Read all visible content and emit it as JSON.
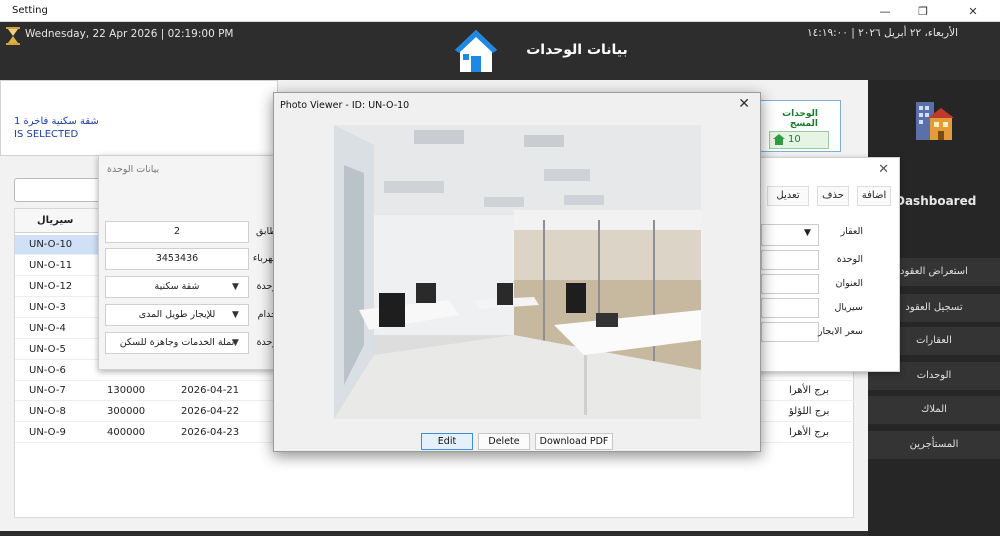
{
  "window": {
    "title": "Setting"
  },
  "topbar": {
    "datetime_en": "Wednesday, 22 Apr 2026  |  02:19:00 PM",
    "datetime_ar": "الأربعاء، ٢٢ أبريل ٢٠٢٦ | ١٤:١٩:٠٠",
    "page_title": "بيانات الوحدات"
  },
  "sidebar": {
    "dashboard_label": "Dashboared",
    "items": [
      {
        "label": "استعراض العقود"
      },
      {
        "label": "تسجيل العقود"
      },
      {
        "label": "العقارات"
      },
      {
        "label": "الوحدات"
      },
      {
        "label": "الملاك"
      },
      {
        "label": "المستأجرين"
      }
    ]
  },
  "info": {
    "line1": "شقة سكنية فاخرة 1",
    "line2": "IS SELECTED"
  },
  "units_card": {
    "title": "الوحدات المسج",
    "count": "10"
  },
  "table": {
    "headers": {
      "serial": "سيريال"
    },
    "rows": [
      {
        "serial": "UN-O-10",
        "price": "",
        "date": "",
        "property": ""
      },
      {
        "serial": "UN-O-11",
        "price": "",
        "date": "",
        "property": ""
      },
      {
        "serial": "UN-O-12",
        "price": "",
        "date": "",
        "property": ""
      },
      {
        "serial": "UN-O-3",
        "price": "",
        "date": "",
        "property": ""
      },
      {
        "serial": "UN-O-4",
        "price": "",
        "date": "",
        "property": ""
      },
      {
        "serial": "UN-O-5",
        "price": "",
        "date": "",
        "property": ""
      },
      {
        "serial": "UN-O-6",
        "price": "",
        "date": "",
        "property": ""
      },
      {
        "serial": "UN-O-7",
        "price": "130000",
        "date": "2026-04-21",
        "property": "برج الأهرا"
      },
      {
        "serial": "UN-O-8",
        "price": "300000",
        "date": "2026-04-22",
        "property": "برج اللؤلؤ"
      },
      {
        "serial": "UN-O-9",
        "price": "400000",
        "date": "2026-04-23",
        "property": "برج الأهرا"
      }
    ]
  },
  "form_dialog": {
    "buttons": {
      "add": "اضافة",
      "delete": "حذف",
      "edit": "تعديل"
    },
    "labels": {
      "property": "العقار",
      "unit": "الوحدة",
      "address": "العنوان",
      "serial": "سيريال",
      "rent_price": "سعر الايجار"
    }
  },
  "units_dialog": {
    "title": "بيانات الوحدة",
    "fields": {
      "floors": "2",
      "electricity": "3453436",
      "unit_type": "شقة سكنية",
      "usage": "للإيجار طويل المدى",
      "status": "تملة الخدمات وجاهزة للسكن"
    },
    "side_labels": {
      "floors": "طابق",
      "electricity": "كهرباء",
      "unit_type": "وحدة",
      "usage": "خدام",
      "status": "وحدة"
    }
  },
  "photo_viewer": {
    "title": "Photo Viewer - ID: UN-O-10",
    "buttons": {
      "edit": "Edit",
      "delete": "Delete",
      "download": "Download PDF"
    }
  },
  "colors": {
    "accent_blue": "#1976d2",
    "selection": "#cfe0f7",
    "count_green": "#1d7a2e"
  }
}
